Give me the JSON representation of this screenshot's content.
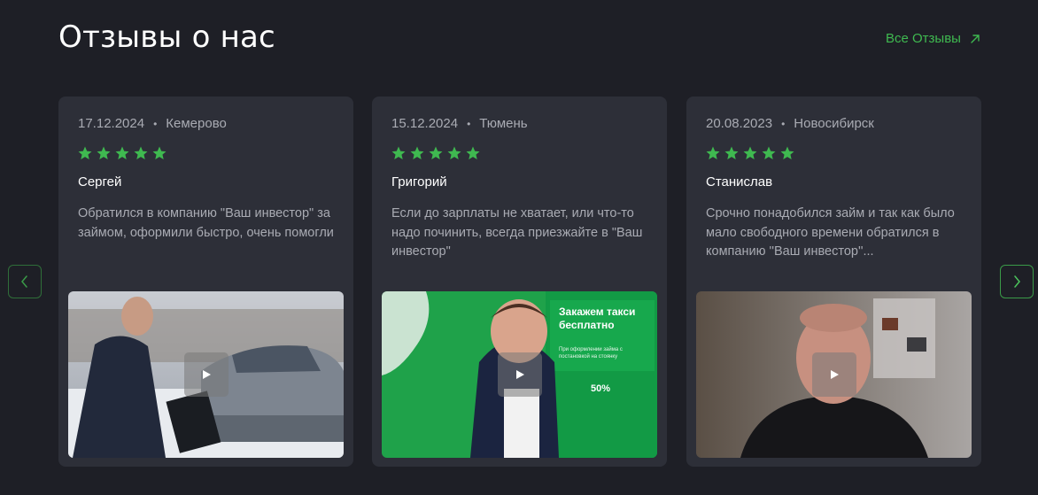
{
  "header": {
    "title": "Отзывы о нас",
    "all_reviews_label": "Все Отзывы"
  },
  "colors": {
    "accent": "#3fb950",
    "background": "#1e1f26",
    "card": "#2d2f38",
    "muted_text": "#a9abb3"
  },
  "reviews": [
    {
      "date": "17.12.2024",
      "city": "Кемерово",
      "rating": 5,
      "name": "Сергей",
      "text": "Обратился в компанию \"Ваш инвестор\" за займом, оформили быстро, очень помогли"
    },
    {
      "date": "15.12.2024",
      "city": "Тюмень",
      "rating": 5,
      "name": "Григорий",
      "text": "Если до зарплаты не хватает, или что-то надо починить, всегда приезжайте в \"Ваш инвестор\""
    },
    {
      "date": "20.08.2023",
      "city": "Новосибирск",
      "rating": 5,
      "name": "Станислав",
      "text": "Срочно понадобился займ и так как было мало свободного времени обратился в компанию ''Ваш инвестор''..."
    }
  ],
  "video2_sign": {
    "heading": "Закажем такси бесплатно",
    "subtext": "При оформлении займа с постановкой на стоянку",
    "percent": "50%"
  },
  "icons": {
    "prev": "chevron-left-icon",
    "next": "chevron-right-icon",
    "arrow": "arrow-up-right-icon",
    "star": "star-icon",
    "play": "play-icon"
  }
}
